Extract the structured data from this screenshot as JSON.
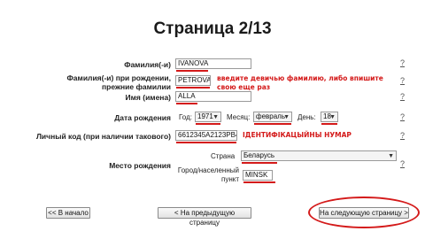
{
  "page_title": "Страница 2/13",
  "help_mark": "?",
  "form": {
    "surname": {
      "label": "Фамилия(-и)",
      "value": "IVANOVA"
    },
    "birth_surname": {
      "label_line1": "Фамилия(-и) при рождении,",
      "label_line2": "прежние фамилии",
      "value": "PETROVA"
    },
    "name": {
      "label": "Имя (имена)",
      "value": "ALLA"
    },
    "birth_date": {
      "label": "Дата рождения",
      "year_label": "Год:",
      "year_value": "1971",
      "month_label": "Месяц:",
      "month_value": "февраль",
      "day_label": "День:",
      "day_value": "18"
    },
    "personal_code": {
      "label": "Личный код (при наличии такового)",
      "value": "6612345A2123PB4"
    },
    "birth_place": {
      "label": "Место рождения",
      "country_label": "Страна",
      "country_value": "Беларусь",
      "city_label_line1": "Город/населенный",
      "city_label_line2": "пункт",
      "city_value": "MINSK"
    }
  },
  "annotations": {
    "maiden_line1": "введите девичью фамилию, либо впишите",
    "maiden_line2": "свою еще раз",
    "id_number": "ІДЕНТИФІКАЦЫЙНЫ НУМАР"
  },
  "buttons": {
    "first": "<< В начало",
    "prev": "< На предыдущую страницу",
    "next": "На следующую страницу >"
  }
}
